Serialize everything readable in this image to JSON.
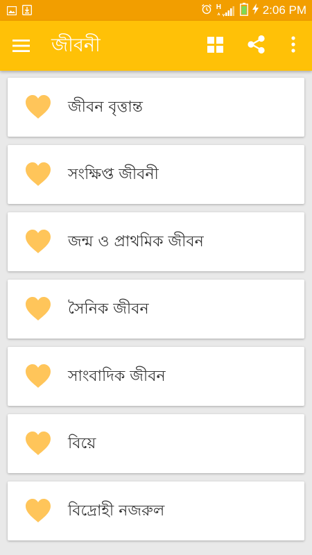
{
  "status_bar": {
    "time": "2:06 PM",
    "network_label": "H",
    "icons": [
      "image-icon",
      "download-icon",
      "alarm-icon",
      "signal-icon",
      "battery-icon",
      "charging-icon"
    ]
  },
  "app_bar": {
    "title": "জীবনী",
    "menu_icon": "hamburger-menu-icon",
    "action_icons": [
      "grid-view-icon",
      "share-icon",
      "more-vert-icon"
    ]
  },
  "list": {
    "items": [
      {
        "label": "জীবন বৃত্তান্ত",
        "icon": "heart-icon"
      },
      {
        "label": "সংক্ষিপ্ত জীবনী",
        "icon": "heart-icon"
      },
      {
        "label": "জন্ম ও প্রাথমিক জীবন",
        "icon": "heart-icon"
      },
      {
        "label": "সৈনিক জীবন",
        "icon": "heart-icon"
      },
      {
        "label": "সাংবাদিক জীবন",
        "icon": "heart-icon"
      },
      {
        "label": "বিয়ে",
        "icon": "heart-icon"
      },
      {
        "label": "বিদ্রোহী নজরুল",
        "icon": "heart-icon"
      }
    ]
  },
  "colors": {
    "status_bar": "#f29e00",
    "app_bar": "#ffc107",
    "heart": "#ffc55a",
    "background": "#e9e9e9",
    "card": "#ffffff",
    "text": "#333333"
  }
}
